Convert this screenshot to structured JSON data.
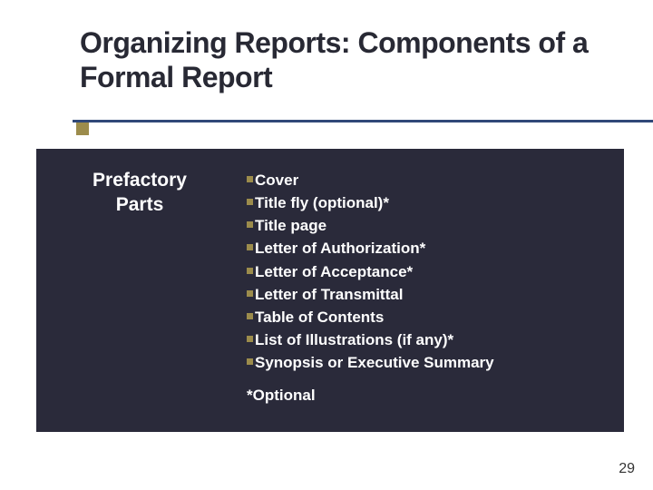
{
  "title": "Organizing Reports: Components of a Formal Report",
  "section_label_line1": "Prefactory",
  "section_label_line2": "Parts",
  "items": {
    "i0": "Cover",
    "i1": "Title fly (optional)*",
    "i2": "Title page",
    "i3": "Letter of Authorization*",
    "i4": "Letter of Acceptance*",
    "i5": "Letter of Transmittal",
    "i6": "Table of Contents",
    "i7": "List of Illustrations (if any)*",
    "i8": "Synopsis or Executive Summary"
  },
  "footnote": "*Optional",
  "page_number": "29"
}
